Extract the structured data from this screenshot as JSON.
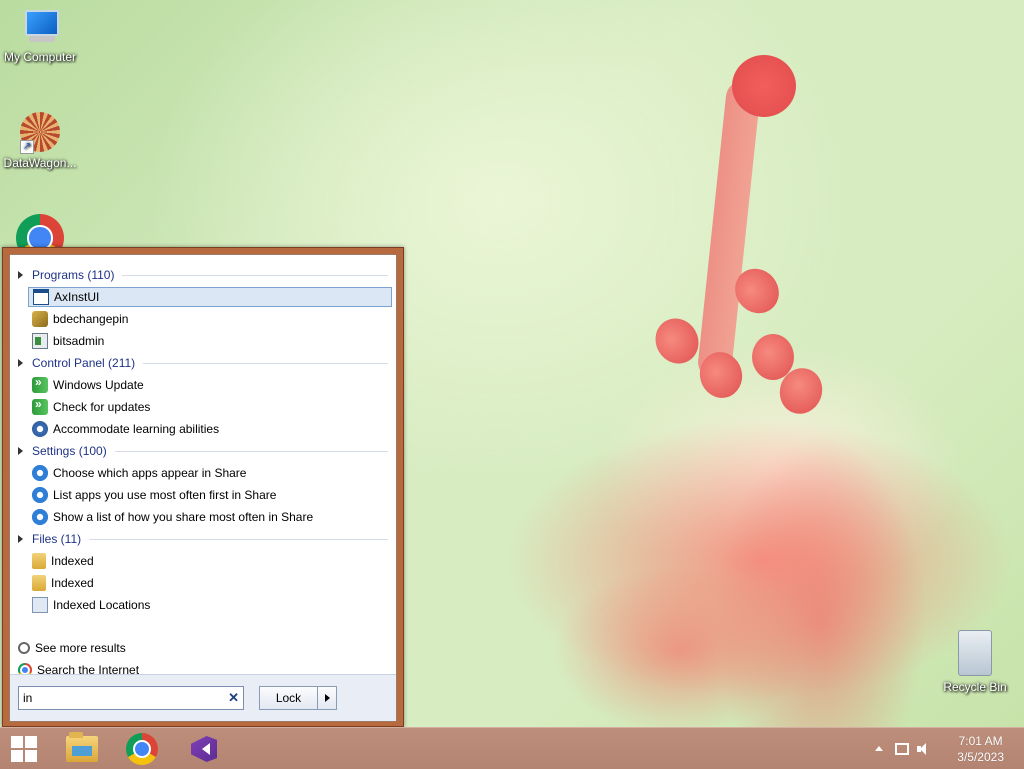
{
  "desktop": {
    "icons": [
      {
        "label": "My Computer"
      },
      {
        "label": "DataWagon..."
      },
      {
        "label": ""
      },
      {
        "label": "Recycle Bin"
      }
    ]
  },
  "start_menu": {
    "groups": [
      {
        "label": "Programs (110)",
        "items": [
          "AxInstUI",
          "bdechangepin",
          "bitsadmin"
        ]
      },
      {
        "label": "Control Panel (211)",
        "items": [
          "Windows Update",
          "Check for updates",
          "Accommodate learning abilities"
        ]
      },
      {
        "label": "Settings (100)",
        "items": [
          "Choose which apps appear in Share",
          "List apps you use most often first in Share",
          "Show a list of how you share most often in Share"
        ]
      },
      {
        "label": "Files (11)",
        "items": [
          "Indexed",
          "Indexed",
          "Indexed Locations"
        ]
      }
    ],
    "selected_item": "AxInstUI",
    "see_more": "See more results",
    "search_internet": "Search the Internet",
    "search": {
      "value": "in"
    },
    "clear_glyph": "✕",
    "lock_label": "Lock"
  },
  "taskbar": {
    "pinned": [
      "start-button",
      "file-explorer",
      "chrome",
      "visual-studio"
    ],
    "clock": {
      "time": "7:01 AM",
      "date": "3/5/2023"
    }
  }
}
